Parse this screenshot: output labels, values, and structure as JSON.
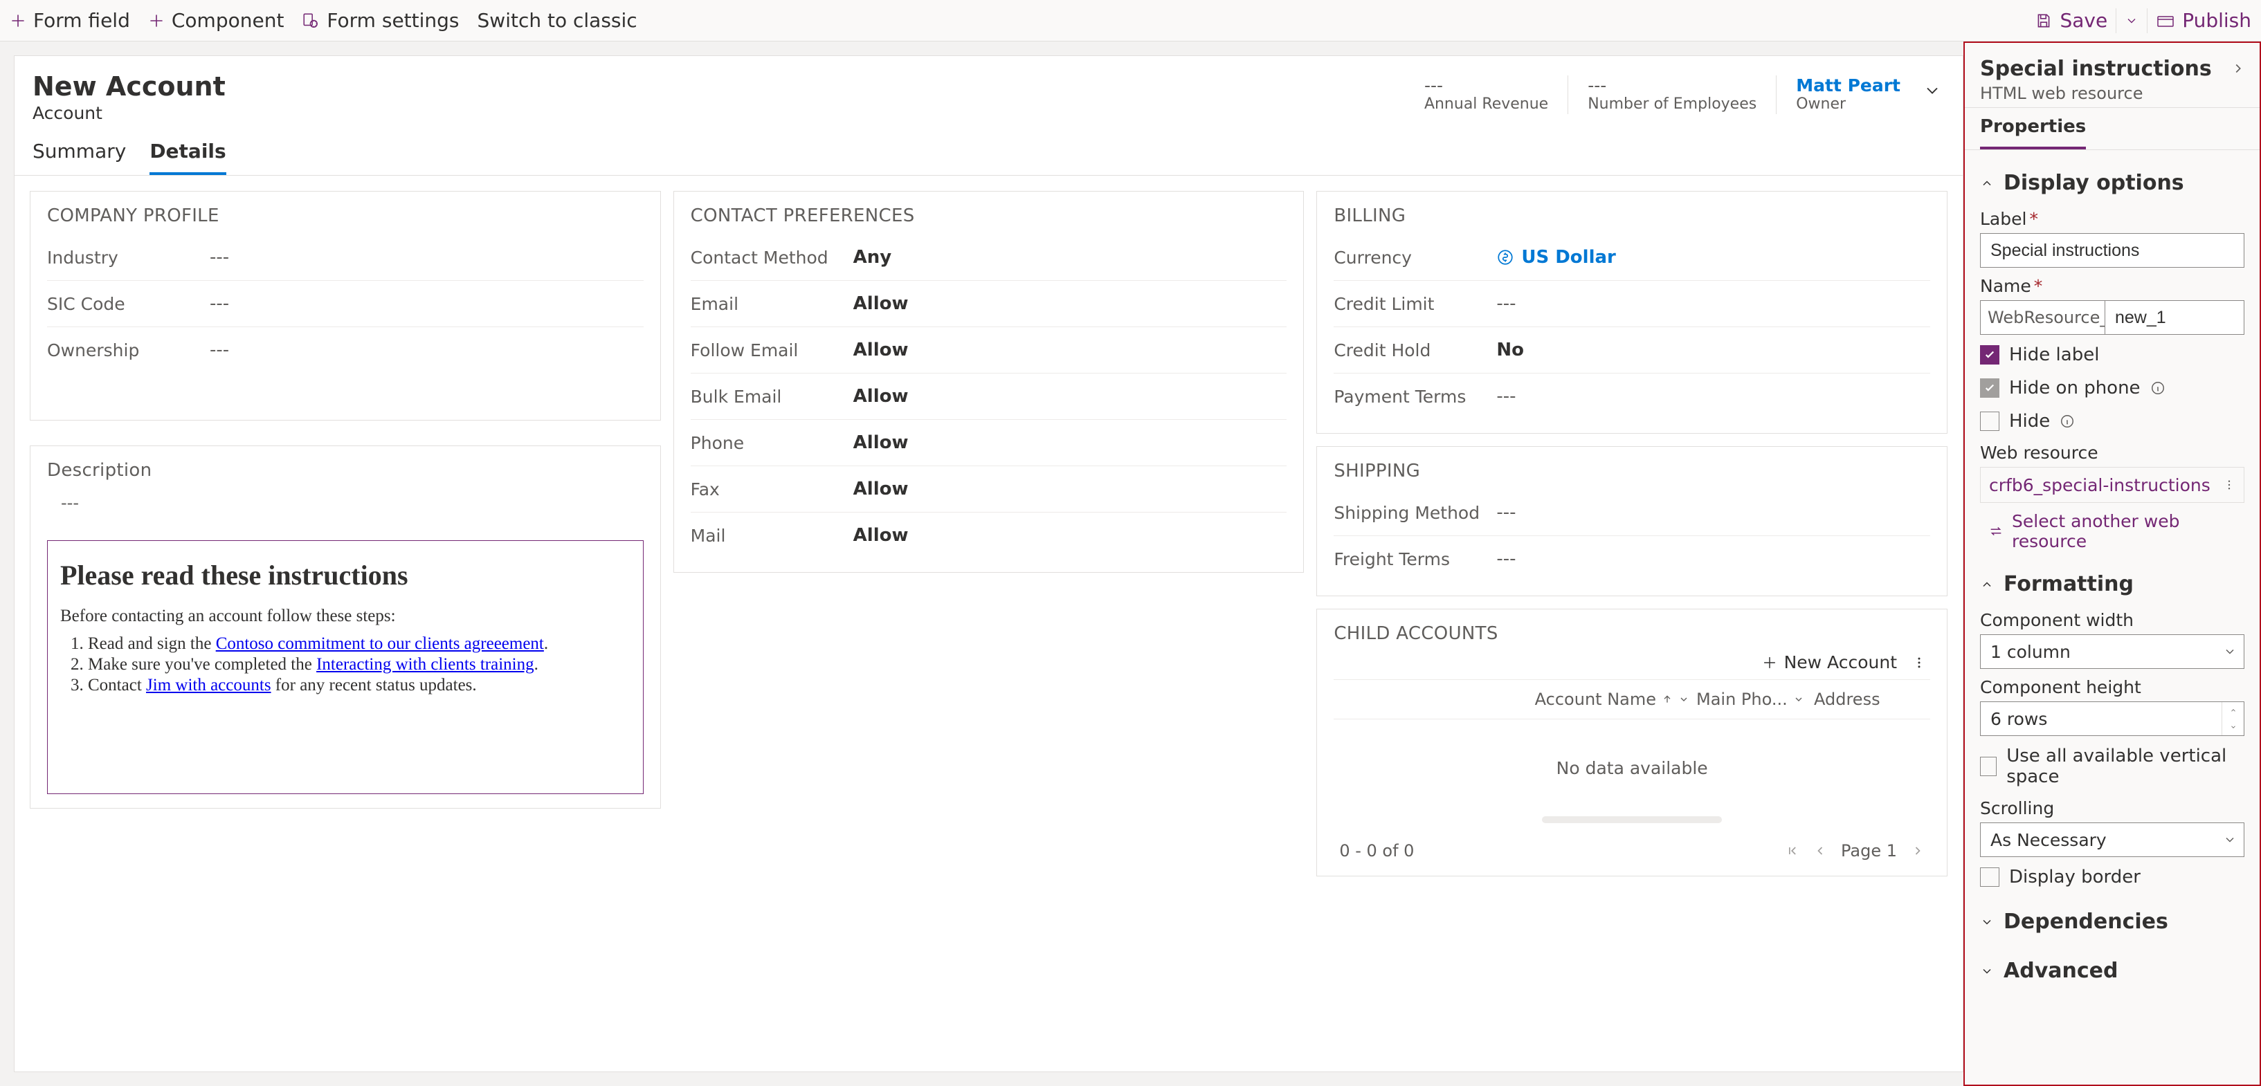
{
  "commandBar": {
    "formField": "Form field",
    "component": "Component",
    "formSettings": "Form settings",
    "switchClassic": "Switch to classic",
    "save": "Save",
    "publish": "Publish"
  },
  "header": {
    "title": "New Account",
    "subtitle": "Account",
    "fields": [
      {
        "value": "---",
        "label": "Annual Revenue"
      },
      {
        "value": "---",
        "label": "Number of Employees"
      }
    ],
    "owner": {
      "value": "Matt Peart",
      "label": "Owner"
    }
  },
  "tabs": {
    "summary": "Summary",
    "details": "Details"
  },
  "companyProfile": {
    "title": "COMPANY PROFILE",
    "rows": [
      {
        "label": "Industry",
        "value": "---"
      },
      {
        "label": "SIC Code",
        "value": "---"
      },
      {
        "label": "Ownership",
        "value": "---"
      }
    ]
  },
  "description": {
    "title": "Description",
    "value": "---",
    "htmlBox": {
      "title": "Please read these instructions",
      "intro": "Before contacting an account follow these steps:",
      "items": [
        {
          "pre": "Read and sign the ",
          "link": "Contoso commitment to our clients agreeement",
          "post": "."
        },
        {
          "pre": "Make sure you've completed the ",
          "link": "Interacting with clients training",
          "post": "."
        },
        {
          "pre": "Contact ",
          "link": "Jim with accounts",
          "post": " for any recent status updates."
        }
      ]
    }
  },
  "contactPrefs": {
    "title": "CONTACT PREFERENCES",
    "rows": [
      {
        "label": "Contact Method",
        "value": "Any"
      },
      {
        "label": "Email",
        "value": "Allow"
      },
      {
        "label": "Follow Email",
        "value": "Allow"
      },
      {
        "label": "Bulk Email",
        "value": "Allow"
      },
      {
        "label": "Phone",
        "value": "Allow"
      },
      {
        "label": "Fax",
        "value": "Allow"
      },
      {
        "label": "Mail",
        "value": "Allow"
      }
    ]
  },
  "billing": {
    "title": "BILLING",
    "currencyLabel": "Currency",
    "currencyValue": "US Dollar",
    "rows": [
      {
        "label": "Credit Limit",
        "value": "---"
      },
      {
        "label": "Credit Hold",
        "value": "No"
      },
      {
        "label": "Payment Terms",
        "value": "---"
      }
    ]
  },
  "shipping": {
    "title": "SHIPPING",
    "rows": [
      {
        "label": "Shipping Method",
        "value": "---"
      },
      {
        "label": "Freight Terms",
        "value": "---"
      }
    ]
  },
  "childAccounts": {
    "title": "CHILD ACCOUNTS",
    "newBtn": "New Account",
    "cols": {
      "name": "Account Name",
      "phone": "Main Pho...",
      "address": "Address"
    },
    "empty": "No data available",
    "count": "0 - 0 of 0",
    "page": "Page 1"
  },
  "panel": {
    "title": "Special instructions",
    "subtitle": "HTML web resource",
    "tab": "Properties",
    "display": {
      "header": "Display options",
      "labelLabel": "Label",
      "labelValue": "Special instructions",
      "nameLabel": "Name",
      "namePrefix": "WebResource_",
      "nameValue": "new_1",
      "hideLabel": "Hide label",
      "hideOnPhone": "Hide on phone",
      "hide": "Hide",
      "webResource": "Web resource",
      "wrValue": "crfb6_special-instructions",
      "wrSwap": "Select another web resource"
    },
    "formatting": {
      "header": "Formatting",
      "widthLabel": "Component width",
      "widthValue": "1 column",
      "heightLabel": "Component height",
      "heightValue": "6 rows",
      "useAll": "Use all available vertical space",
      "scrollingLabel": "Scrolling",
      "scrollingValue": "As Necessary",
      "displayBorder": "Display border"
    },
    "dependencies": "Dependencies",
    "advanced": "Advanced"
  }
}
